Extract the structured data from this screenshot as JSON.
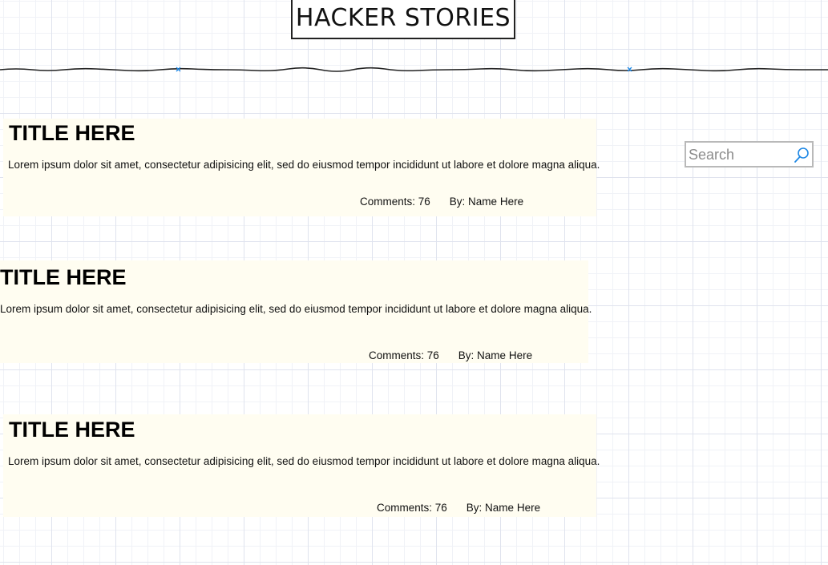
{
  "header": {
    "title": "HACKER STORIES"
  },
  "search": {
    "placeholder": "Search",
    "value": ""
  },
  "stories": [
    {
      "title": "TITLE HERE",
      "body": "Lorem ipsum dolor sit amet, consectetur adipisicing elit, sed do eiusmod tempor incididunt ut labore et dolore magna aliqua.",
      "comments": "Comments: 76",
      "author": "By: Name Here"
    },
    {
      "title": "TITLE HERE",
      "body": "Lorem ipsum dolor sit amet, consectetur adipisicing elit, sed do eiusmod tempor incididunt ut labore et dolore magna aliqua.",
      "comments": "Comments: 76",
      "author": "By: Name Here"
    },
    {
      "title": "TITLE HERE",
      "body": "Lorem ipsum dolor sit amet, consectetur adipisicing elit, sed do eiusmod tempor incididunt ut labore et dolore magna aliqua.",
      "comments": "Comments: 76",
      "author": "By: Name Here"
    }
  ],
  "icons": {
    "search": "search-icon",
    "divider_marker": "x-marker-icon"
  },
  "colors": {
    "card_background": "#fffdf1",
    "accent": "#1e88e5"
  }
}
